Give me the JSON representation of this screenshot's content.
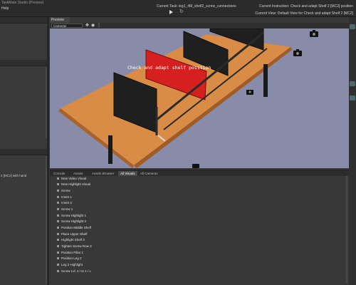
{
  "app": {
    "title": "TaskMate Studio (Preview)",
    "menu_help": "Help"
  },
  "header": {
    "current_task": "Current Task: leg1_4M_shelf2_screw_connections",
    "current_instruction": "Current Instruction: Check and adapt Shelf 2 [MC2] position",
    "current_view": "Current View: Default View for Check and adapt Shelf 2 [MC2]"
  },
  "left_panel": {
    "label": "2 [MC2] with hand"
  },
  "preview": {
    "tab_label": "Preview",
    "camera_select": "Cameras",
    "overlay_text": "Check and adapt shelf position"
  },
  "bottom_tabs": [
    {
      "label": "Console",
      "active": false
    },
    {
      "label": "Assets",
      "active": false
    },
    {
      "label": "Assets Browser",
      "active": false
    },
    {
      "label": "All Visuals",
      "active": true
    },
    {
      "label": "All Cameras",
      "active": false
    }
  ],
  "visuals": [
    "New Video Visual",
    "New Highlight Visual",
    "Screw",
    "Insert 1",
    "Insert 2",
    "Screw 1",
    "Screw Highlight 1",
    "Screw Highlight 2",
    "Position Middle Shelf",
    "Place Upper Shelf",
    "Highlight Shelf 3",
    "Tighten Screw Row 3",
    "Position Pillar 1",
    "Position Leg 2",
    "Leg 2 Highlight",
    "Screw Lvl. 2 / In 1 / L"
  ],
  "colors": {
    "viewport_bg": "#888ca8",
    "table_wood": "#d98c45",
    "shelf_black": "#1f1f1f",
    "shelf_red": "#d62020",
    "accent_teal": "#4b6a72"
  }
}
